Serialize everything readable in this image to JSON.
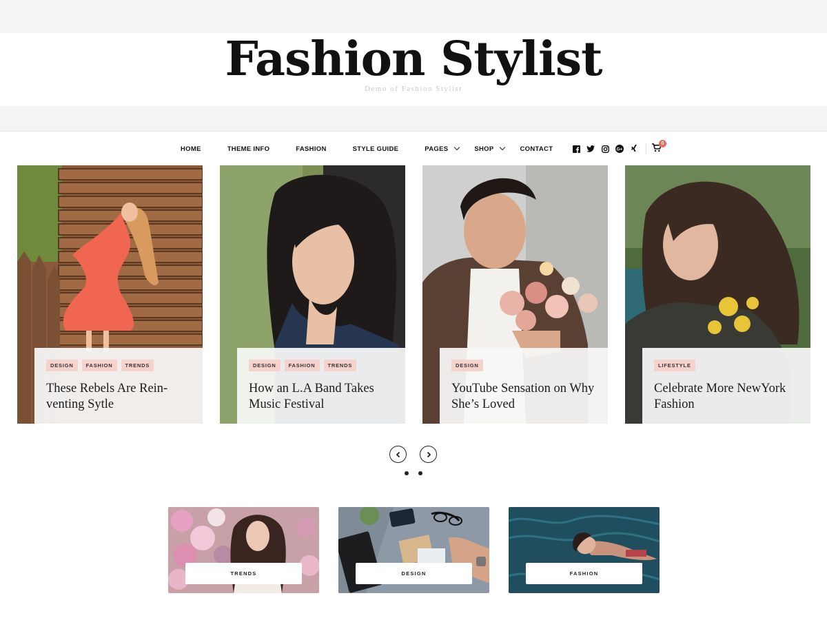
{
  "site": {
    "title": "Fashion Stylist",
    "tagline": "Demo of Fashion Stylist"
  },
  "nav": {
    "items": [
      {
        "label": "HOME",
        "has_dropdown": false
      },
      {
        "label": "THEME INFO",
        "has_dropdown": false
      },
      {
        "label": "FASHION",
        "has_dropdown": false
      },
      {
        "label": "STYLE GUIDE",
        "has_dropdown": false
      },
      {
        "label": "PAGES",
        "has_dropdown": true
      },
      {
        "label": "SHOP",
        "has_dropdown": true
      },
      {
        "label": "CONTACT",
        "has_dropdown": false
      }
    ]
  },
  "social": {
    "icons": [
      "facebook-icon",
      "twitter-icon",
      "instagram-icon",
      "google-plus-icon",
      "xing-icon"
    ],
    "cart_count": "0"
  },
  "slider": {
    "slides": [
      {
        "tags": [
          "DESIGN",
          "FASHION",
          "TRENDS"
        ],
        "title": "These Rebels Are Rein-venting Sytle"
      },
      {
        "tags": [
          "DESIGN",
          "FASHION",
          "TRENDS"
        ],
        "title": "How an L.A Band Takes Music Festival"
      },
      {
        "tags": [
          "DESIGN"
        ],
        "title": "YouTube Sensation on Why She’s Loved"
      },
      {
        "tags": [
          "LIFESTYLE"
        ],
        "title": "Celebrate More NewYork Fashion"
      }
    ],
    "page_dots": 2
  },
  "categories": [
    {
      "label": "TRENDS"
    },
    {
      "label": "DESIGN"
    },
    {
      "label": "FASHION"
    }
  ],
  "colors": {
    "accent": "#e46f5e",
    "tag_bg": "#f5d2cb",
    "text": "#111111"
  }
}
